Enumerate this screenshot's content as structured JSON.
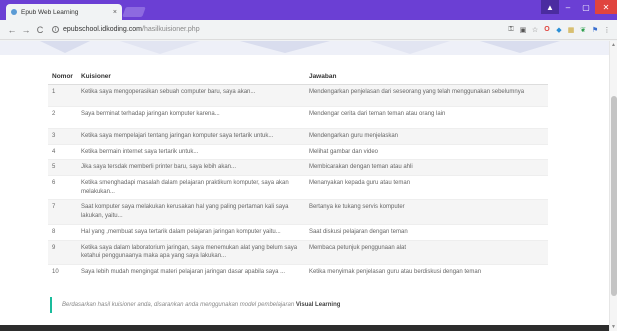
{
  "browser": {
    "tab_title": "Epub Web Learning",
    "tab_close": "×",
    "url_host": "epubschool.idkoding.com",
    "url_path": "/hasilkuisioner.php",
    "win_min": "–",
    "win_max": "▢",
    "win_close": "✕",
    "win_user": "▲",
    "back": "←",
    "forward": "→",
    "reload": "C"
  },
  "table": {
    "headers": {
      "no": "Nomor",
      "question": "Kuisioner",
      "answer": "Jawaban"
    },
    "rows": [
      {
        "no": "1",
        "q": "Ketika saya mengoperasikan sebuah computer baru, saya akan...",
        "a": "Mendengarkan penjelasan dari seseorang yang telah menggunakan sebelumnya"
      },
      {
        "no": "2",
        "q": "Saya berminat terhadap jaringan komputer karena...",
        "a": "Mendengar cerita dari teman teman atau orang lain"
      },
      {
        "no": "3",
        "q": "Ketika saya mempelajari tentang jaringan komputer saya tertarik untuk...",
        "a": "Mendengarkan guru menjelaskan"
      },
      {
        "no": "4",
        "q": "Ketika bermain internet saya tertarik untuk...",
        "a": "Melihat gambar dan video"
      },
      {
        "no": "5",
        "q": "Jika saya tersdak memberli printer baru, saya lebih akan...",
        "a": "Membicarakan dengan teman atau ahli"
      },
      {
        "no": "6",
        "q": "Ketika smenghadapi masalah dalam pelajaran praktikum komputer, saya akan melakukan...",
        "a": "Menanyakan kepada guru atau teman"
      },
      {
        "no": "7",
        "q": "Saat komputer saya melakukan kerusakan hal yang paling pertaman kali saya lakukan, yaitu...",
        "a": "Bertanya ke tukang servis komputer"
      },
      {
        "no": "8",
        "q": "Hal yang ,membuat saya tertarik dalam pelajaran jaringan komputer yaitu...",
        "a": "Saat diskusi pelajaran dengan teman"
      },
      {
        "no": "9",
        "q": "Ketika saya dalam laboratorium jaringan, saya menemukan alat yang belum saya ketahui penggunaanya maka apa yang saya lakukan...",
        "a": "Membaca petunjuk penggunaan alat"
      },
      {
        "no": "10",
        "q": "Saya lebih mudah mengingat materi pelajaran jaringan dasar apabila saya ...",
        "a": "Ketika menyimak penjelasan guru atau berdiskusi dengan teman"
      }
    ]
  },
  "note": {
    "text": "Berdasarkan hasil kuisioner anda, disarankan anda menggunakan model pembelajaran",
    "model": "Visual Learning"
  },
  "colors": {
    "titlebar": "#6b3fd4",
    "accent": "#1abc9c",
    "footer": "#2d2d2d"
  }
}
